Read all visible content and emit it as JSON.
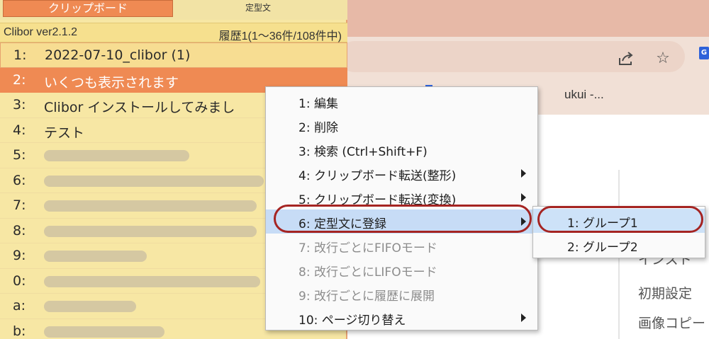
{
  "browser": {
    "bookmark_text": "ukui -...",
    "content_lines": [
      "インスト",
      "初期設定",
      "画像コピー"
    ],
    "icons": [
      "share-icon",
      "star-icon",
      "google-extension-icon"
    ],
    "extension_letter": "G"
  },
  "clibor": {
    "tabs": {
      "clipboard": "クリップボード",
      "teikei": "定型文"
    },
    "header": {
      "version": "Clibor ver2.1.2",
      "history": "履歴1(1〜36件/108件中)"
    },
    "items": [
      {
        "key": "1:",
        "text": "2022-07-10_clibor (1)"
      },
      {
        "key": "2:",
        "text": "いくつも表示されます"
      },
      {
        "key": "3:",
        "text": "Clibor インストールしてみまし"
      },
      {
        "key": "4:",
        "text": "テスト"
      },
      {
        "key": "5:",
        "text": ""
      },
      {
        "key": "6:",
        "text": ""
      },
      {
        "key": "7:",
        "text": ""
      },
      {
        "key": "8:",
        "text": ""
      },
      {
        "key": "9:",
        "text": ""
      },
      {
        "key": "0:",
        "text": ""
      },
      {
        "key": "a:",
        "text": ""
      },
      {
        "key": "b:",
        "text": ""
      }
    ]
  },
  "context_menu": {
    "items": [
      {
        "label": "1: 編集",
        "submenu": false,
        "disabled": false
      },
      {
        "label": "2: 削除",
        "submenu": false,
        "disabled": false
      },
      {
        "label": "3: 検索 (Ctrl+Shift+F)",
        "submenu": false,
        "disabled": false
      },
      {
        "label": "4: クリップボード転送(整形)",
        "submenu": true,
        "disabled": false
      },
      {
        "label": "5: クリップボード転送(変換)",
        "submenu": true,
        "disabled": false
      },
      {
        "label": "6: 定型文に登録",
        "submenu": true,
        "disabled": false,
        "highlighted": true
      },
      {
        "label": "7: 改行ごとにFIFOモード",
        "submenu": false,
        "disabled": true
      },
      {
        "label": "8: 改行ごとにLIFOモード",
        "submenu": false,
        "disabled": true
      },
      {
        "label": "9: 改行ごとに履歴に展開",
        "submenu": false,
        "disabled": true
      },
      {
        "label": "10: ページ切り替え",
        "submenu": true,
        "disabled": false
      }
    ]
  },
  "submenu": {
    "items": [
      {
        "label": "1: グループ1",
        "highlighted": true
      },
      {
        "label": "2: グループ2",
        "highlighted": false
      }
    ]
  },
  "colors": {
    "accent_orange": "#ef8a53",
    "list_background": "#f7e7a4",
    "menu_highlight": "#c7dcf6",
    "annotation_red": "#a52422"
  }
}
